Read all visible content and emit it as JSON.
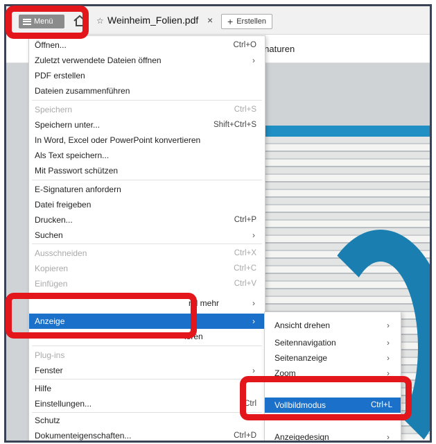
{
  "tabbar": {
    "menu_label": "Menü",
    "tab_title": "Weinheim_Folien.pdf",
    "tab_close": "×",
    "create_label": "Erstellen",
    "create_plus": "+"
  },
  "toolbar": {
    "partial_label": "ignaturen"
  },
  "menu": {
    "items": [
      {
        "label": "Öffnen...",
        "shortcut": "Ctrl+O"
      },
      {
        "label": "Zuletzt verwendete Dateien öffnen",
        "arrow": "›"
      },
      {
        "label": "PDF erstellen"
      },
      {
        "label": "Dateien zusammenführen"
      },
      {
        "label": "Speichern",
        "shortcut": "Ctrl+S"
      },
      {
        "label": "Speichern unter...",
        "shortcut": "Shift+Ctrl+S"
      },
      {
        "label": "In Word, Excel oder PowerPoint konvertieren"
      },
      {
        "label": "Als Text speichern..."
      },
      {
        "label": "Mit Passwort schützen"
      },
      {
        "label": "E-Signaturen anfordern"
      },
      {
        "label": "Datei freigeben"
      },
      {
        "label": "Drucken...",
        "shortcut": "Ctrl+P"
      },
      {
        "label": "Suchen",
        "arrow": "›"
      },
      {
        "label": "Ausschneiden",
        "shortcut": "Ctrl+X"
      },
      {
        "label": "Kopieren",
        "shortcut": "Ctrl+C"
      },
      {
        "label": "Einfügen",
        "shortcut": "Ctrl+V"
      },
      {
        "label": "nd mehr",
        "arrow": "›"
      },
      {
        "label": "Anzeige",
        "arrow": "›"
      },
      {
        "label": "ieren"
      },
      {
        "label": "Plug-ins"
      },
      {
        "label": "Fenster",
        "arrow": "›"
      },
      {
        "label": "Hilfe"
      },
      {
        "label": "Einstellungen...",
        "shortcut": "Ctrl"
      },
      {
        "label": "Schutz"
      },
      {
        "label": "Dokumenteigenschaften...",
        "shortcut": "Ctrl+D"
      }
    ]
  },
  "submenu": {
    "items": [
      {
        "label": "Ansicht drehen",
        "arrow": "›"
      },
      {
        "label": "Seitennavigation",
        "arrow": "›"
      },
      {
        "label": "Seitenanzeige",
        "arrow": "›"
      },
      {
        "label": "Zoom",
        "arrow": "›"
      },
      {
        "label": "Vollbildmodus",
        "shortcut": "Ctrl+L"
      },
      {
        "label": "Anzeigedesign",
        "arrow": "›"
      }
    ]
  },
  "colors": {
    "highlight": "#1b70c9",
    "annotation": "#e3161b",
    "frame": "#3a4256"
  }
}
